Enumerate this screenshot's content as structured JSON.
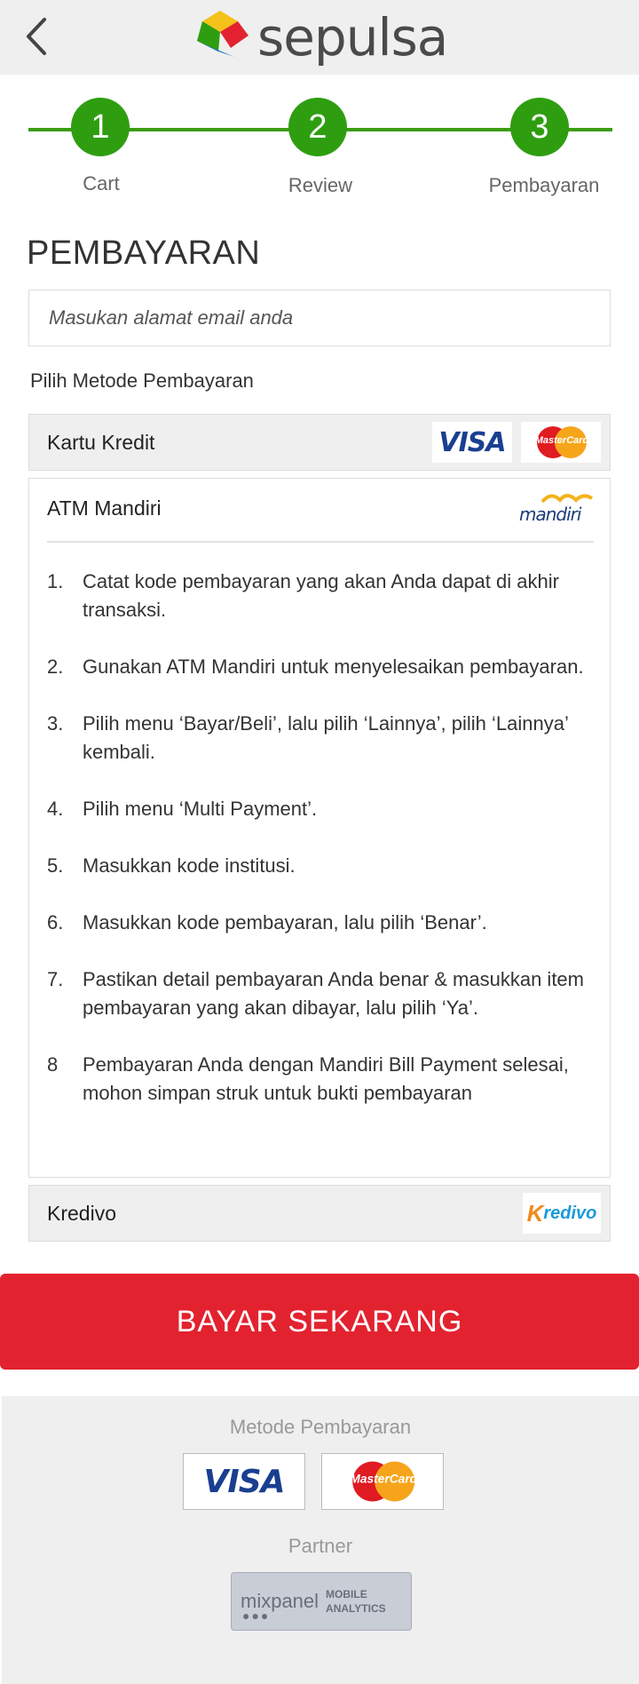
{
  "header": {
    "logo_text": "sepulsa",
    "back_icon": "chevron-left-icon"
  },
  "stepper": {
    "steps": [
      {
        "number": "1",
        "label": "Cart"
      },
      {
        "number": "2",
        "label": "Review"
      },
      {
        "number": "3",
        "label": "Pembayaran"
      }
    ]
  },
  "page_title": "PEMBAYARAN",
  "email": {
    "placeholder": "Masukan alamat email anda",
    "value": ""
  },
  "payment_methods_label": "Pilih Metode Pembayaran",
  "payment_methods": {
    "credit_card": {
      "label": "Kartu Kredit",
      "logos": [
        "VISA",
        "MasterCard"
      ]
    },
    "atm_mandiri": {
      "label": "ATM Mandiri",
      "logo": "mandiri",
      "expanded": true,
      "instructions": [
        {
          "num": "1.",
          "text": "Catat kode pembayaran yang akan Anda dapat di akhir transaksi."
        },
        {
          "num": "2.",
          "text": "Gunakan ATM Mandiri untuk menyelesaikan pembayaran."
        },
        {
          "num": "3.",
          "text": "Pilih menu ‘Bayar/Beli’, lalu pilih ‘Lainnya’, pilih ‘Lainnya’ kembali."
        },
        {
          "num": "4.",
          "text": "Pilih menu ‘Multi Payment’."
        },
        {
          "num": "5.",
          "text": "Masukkan kode institusi."
        },
        {
          "num": "6.",
          "text": "Masukkan kode pembayaran, lalu pilih ‘Benar’."
        },
        {
          "num": "7.",
          "text": "Pastikan detail pembayaran Anda benar & masukkan item pembayaran yang akan dibayar, lalu pilih ‘Ya’."
        },
        {
          "num": "8",
          "text": "Pembayaran Anda dengan Mandiri Bill Payment selesai, mohon simpan struk untuk bukti pembayaran"
        }
      ]
    },
    "kredivo": {
      "label": "Kredivo",
      "logo_k": "K",
      "logo_rest": "redivo"
    }
  },
  "pay_button": "BAYAR SEKARANG",
  "footer": {
    "methods_label": "Metode Pembayaran",
    "partner_label": "Partner",
    "visa": "VISA",
    "mastercard": "MasterCard",
    "mixpanel": {
      "name": "mixpanel",
      "tag_1": "MOBILE",
      "tag_2": "ANALYTICS"
    }
  },
  "colors": {
    "accent_green": "#2e9e10",
    "pay_red": "#e3222f",
    "visa_blue": "#1a3f91",
    "gray_bg": "#efefef"
  }
}
